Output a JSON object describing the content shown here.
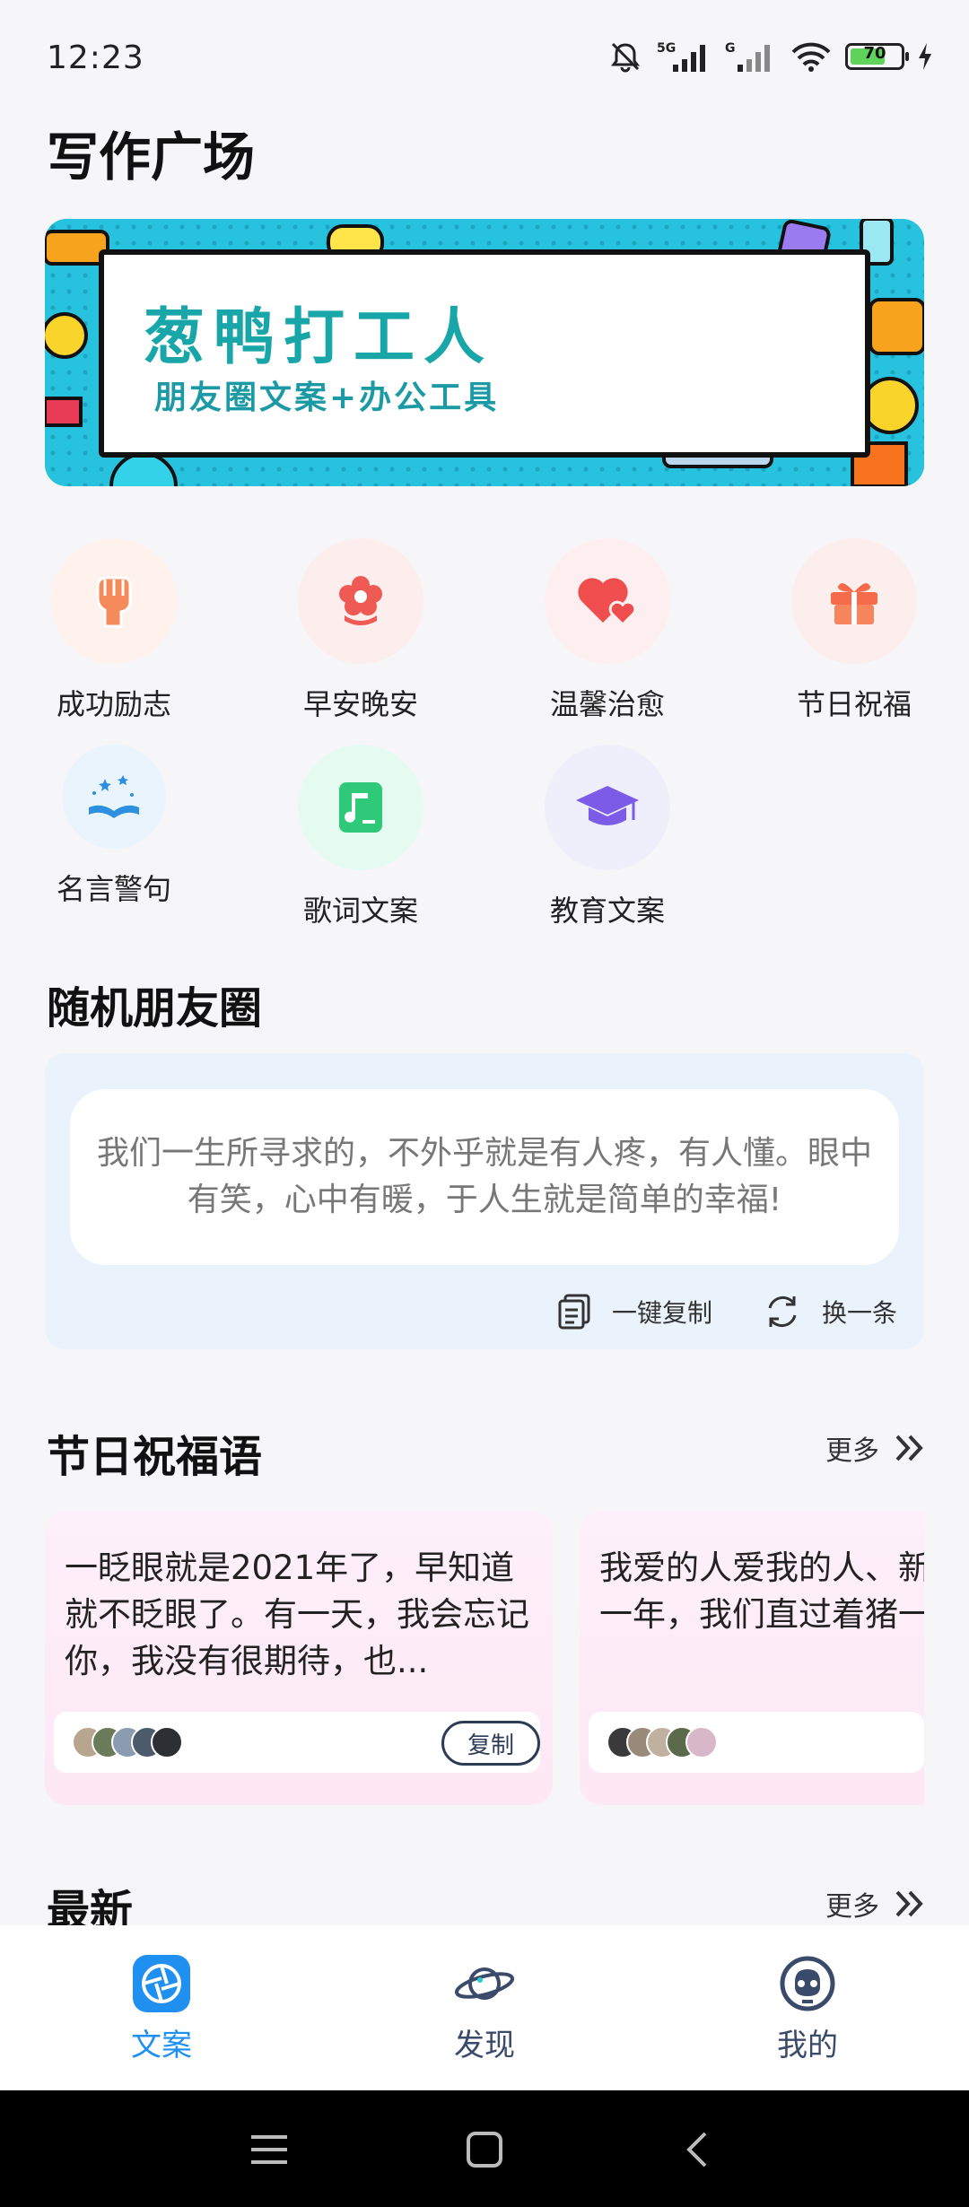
{
  "status": {
    "time": "12:23",
    "battery": "70",
    "network1": "5G",
    "network2": "G"
  },
  "page_title": "写作广场",
  "banner": {
    "title": "葱鸭打工人",
    "subtitle": "朋友圈文案+办公工具"
  },
  "categories": [
    {
      "label": "成功励志",
      "icon": "fist-icon",
      "bg": "#fff1ec"
    },
    {
      "label": "早安晚安",
      "icon": "flower-icon",
      "bg": "#fdeeee"
    },
    {
      "label": "温馨治愈",
      "icon": "heart-icon",
      "bg": "#fdeff0"
    },
    {
      "label": "节日祝福",
      "icon": "gift-icon",
      "bg": "#fdeeee"
    },
    {
      "label": "名言警句",
      "icon": "book-stars-icon",
      "bg": "#e9f4fd"
    },
    {
      "label": "歌词文案",
      "icon": "music-note-icon",
      "bg": "#e5faf0"
    },
    {
      "label": "教育文案",
      "icon": "graduation-cap-icon",
      "bg": "#efeffc"
    }
  ],
  "random": {
    "title": "随机朋友圈",
    "text": "我们一生所寻求的，不外乎就是有人疼，有人懂。眼中有笑，心中有暖，于人生就是简单的幸福!",
    "copy_label": "一键复制",
    "refresh_label": "换一条"
  },
  "holiday": {
    "title": "节日祝福语",
    "more_label": "更多",
    "cards": [
      {
        "text": "一眨眼就是2021年了，早知道就不眨眼了。有一天，我会忘记你，我没有很期待，也...",
        "copy_label": "复制"
      },
      {
        "text": "我爱的人爱我的人、新乐。回想这一年，我们直过着猪一样的生活，"
      }
    ]
  },
  "latest": {
    "title": "最新",
    "more_label": "更多"
  },
  "nav": [
    {
      "label": "文案",
      "icon": "aperture-icon",
      "active": true
    },
    {
      "label": "发现",
      "icon": "planet-icon",
      "active": false
    },
    {
      "label": "我的",
      "icon": "robot-face-icon",
      "active": false
    }
  ],
  "colors": {
    "accent": "#1f8ff0",
    "nav_text": "#3a4a6a",
    "banner_bg": "#27c2de",
    "banner_text": "#19a6a8"
  }
}
